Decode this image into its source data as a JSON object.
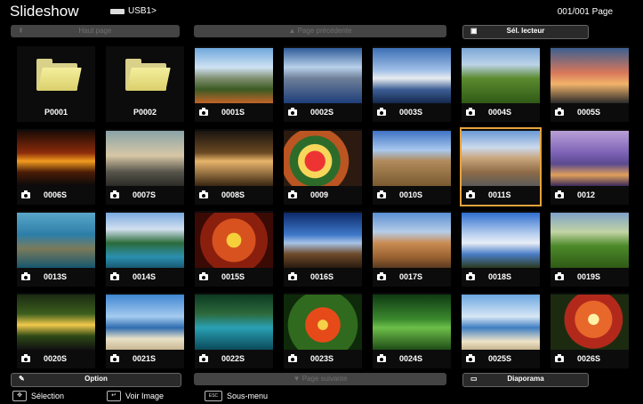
{
  "header": {
    "title": "Slideshow",
    "source": "USB1>",
    "page_count": "001/001 Page"
  },
  "nav": {
    "haut_page": "Haut page",
    "page_precedente": "Page précédente",
    "sel_lecteur": "Sél. lecteur"
  },
  "bottom_nav": {
    "option": "Option",
    "page_suivante": "Page suivante",
    "diaporama": "Diaporama"
  },
  "footer": {
    "selection": "Sélection",
    "voir_image": "Voir Image",
    "esc_key": "ESC",
    "sous_menu": "Sous-menu"
  },
  "items": [
    {
      "label": "P0001",
      "kind": "folder"
    },
    {
      "label": "P0002",
      "kind": "folder"
    },
    {
      "label": "0001S",
      "kind": "photo"
    },
    {
      "label": "0002S",
      "kind": "photo"
    },
    {
      "label": "0003S",
      "kind": "photo"
    },
    {
      "label": "0004S",
      "kind": "photo"
    },
    {
      "label": "0005S",
      "kind": "photo"
    },
    {
      "label": "0006S",
      "kind": "photo"
    },
    {
      "label": "0007S",
      "kind": "photo"
    },
    {
      "label": "0008S",
      "kind": "photo"
    },
    {
      "label": "0009",
      "kind": "photo"
    },
    {
      "label": "0010S",
      "kind": "photo"
    },
    {
      "label": "0011S",
      "kind": "photo",
      "selected": true
    },
    {
      "label": "0012",
      "kind": "photo"
    },
    {
      "label": "0013S",
      "kind": "photo"
    },
    {
      "label": "0014S",
      "kind": "photo"
    },
    {
      "label": "0015S",
      "kind": "photo"
    },
    {
      "label": "0016S",
      "kind": "photo"
    },
    {
      "label": "0017S",
      "kind": "photo"
    },
    {
      "label": "0018S",
      "kind": "photo"
    },
    {
      "label": "0019S",
      "kind": "photo"
    },
    {
      "label": "0020S",
      "kind": "photo"
    },
    {
      "label": "0021S",
      "kind": "photo"
    },
    {
      "label": "0022S",
      "kind": "photo"
    },
    {
      "label": "0023S",
      "kind": "photo"
    },
    {
      "label": "0024S",
      "kind": "photo"
    },
    {
      "label": "0025S",
      "kind": "photo"
    },
    {
      "label": "0026S",
      "kind": "photo"
    }
  ],
  "colors": {
    "selection": "#e6a23c",
    "folder": "#f0e68c"
  }
}
